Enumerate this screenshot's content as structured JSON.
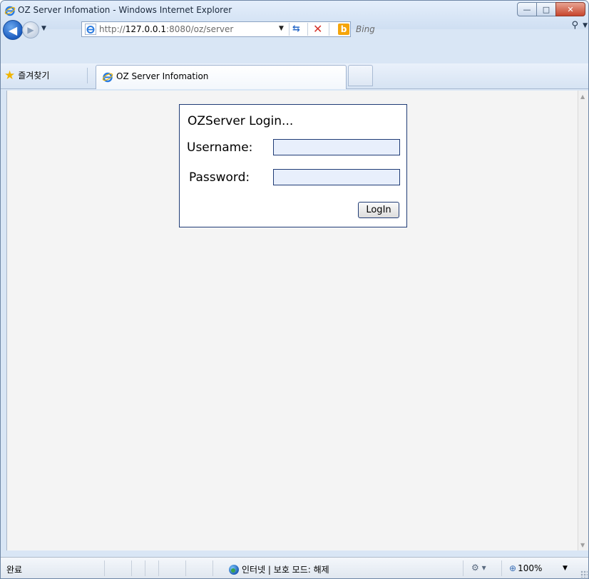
{
  "window": {
    "title": "OZ Server Infomation - Windows Internet Explorer",
    "controls": {
      "minimize": "—",
      "maximize": "□",
      "close": "✕"
    }
  },
  "navigation": {
    "back_glyph": "◀",
    "forward_glyph": "▶",
    "address": {
      "url_prefix": "http://",
      "url_host": "127.0.0.1",
      "url_suffix": ":8080/oz/server"
    },
    "search": {
      "placeholder": "Bing",
      "engine_logo": "b"
    }
  },
  "favorites_bar": {
    "favorites_label": "즐겨찾기",
    "tab_label": "OZ Server Infomation"
  },
  "login": {
    "title": "OZServer Login...",
    "username_label": "Username:",
    "password_label": "Password:",
    "username_value": "",
    "password_value": "",
    "login_button": "LogIn"
  },
  "status_bar": {
    "status": "완료",
    "zone": "인터넷 | 보호 모드: 해제",
    "zoom": "100%"
  },
  "icons": [
    "ie-icon",
    "back-icon",
    "forward-icon",
    "refresh-icon",
    "stop-icon",
    "bing-icon",
    "search-icon",
    "star-icon",
    "globe-icon",
    "security-icon",
    "zoom-icon"
  ],
  "colors": {
    "accent": "#1f3b75",
    "field_bg": "#e8effc",
    "content_bg": "#f4f4f4"
  }
}
